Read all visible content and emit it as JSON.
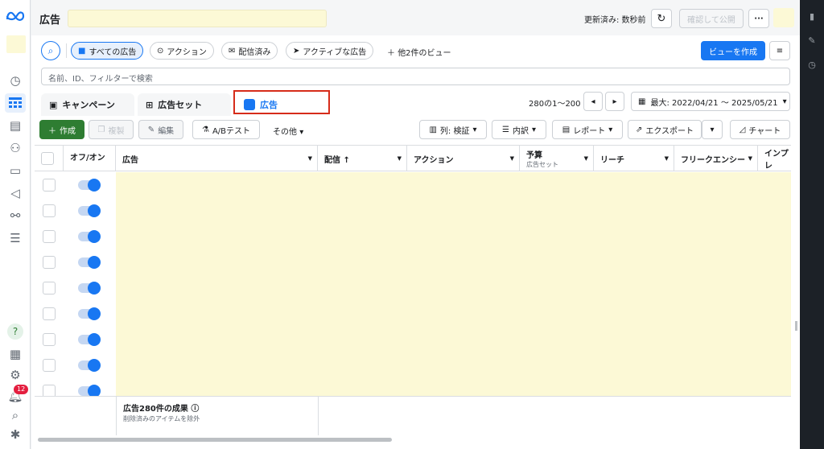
{
  "colors": {
    "accent": "#1877f2",
    "highlight": "#d62c1a",
    "create": "#2e7d32"
  },
  "leftnav": {
    "icons": [
      "meta-logo",
      "dashboard-icon",
      "table-icon",
      "pages-icon",
      "people-icon",
      "billing-icon",
      "megaphone-icon",
      "network-icon",
      "menu-icon",
      "help-icon",
      "news-icon",
      "settings-icon",
      "bell-icon",
      "search-icon",
      "bug-icon"
    ],
    "notification_count": "12"
  },
  "header": {
    "title": "広告",
    "updated": "更新済み: 数秒前",
    "publish_label": "確認して公開",
    "more_label": "···"
  },
  "views": {
    "all_ads": "すべての広告",
    "action": "アクション",
    "delivered": "配信済み",
    "active_ads": "アクティブな広告",
    "more_views": "他2件のビュー",
    "create_view": "ビューを作成"
  },
  "search": {
    "placeholder": "名前、ID、フィルターで検索"
  },
  "tabs": {
    "campaign": "キャンペーン",
    "adset": "広告セット",
    "ad": "広告"
  },
  "pager": {
    "range": "280の1〜200",
    "date_range": "最大: 2022/04/21 〜 2025/05/21"
  },
  "actions": {
    "create": "作成",
    "duplicate": "複製",
    "edit": "編集",
    "ab_test": "A/Bテスト",
    "other": "その他",
    "columns": "列: 検証",
    "breakdown": "内訳",
    "report": "レポート",
    "export": "エクスポート",
    "chart": "チャート"
  },
  "table": {
    "headers": {
      "onoff": "オフ/オン",
      "ad": "広告",
      "delivery": "配信 ↑",
      "action": "アクション",
      "budget": "予算",
      "budget_sub": "広告セット",
      "reach": "リーチ",
      "frequency": "フリークエンシー",
      "impressions": "インプレ"
    },
    "row_count_visible": 9,
    "footer_result": "広告280件の成果",
    "footer_note": "削除済みのアイテムを除外"
  }
}
